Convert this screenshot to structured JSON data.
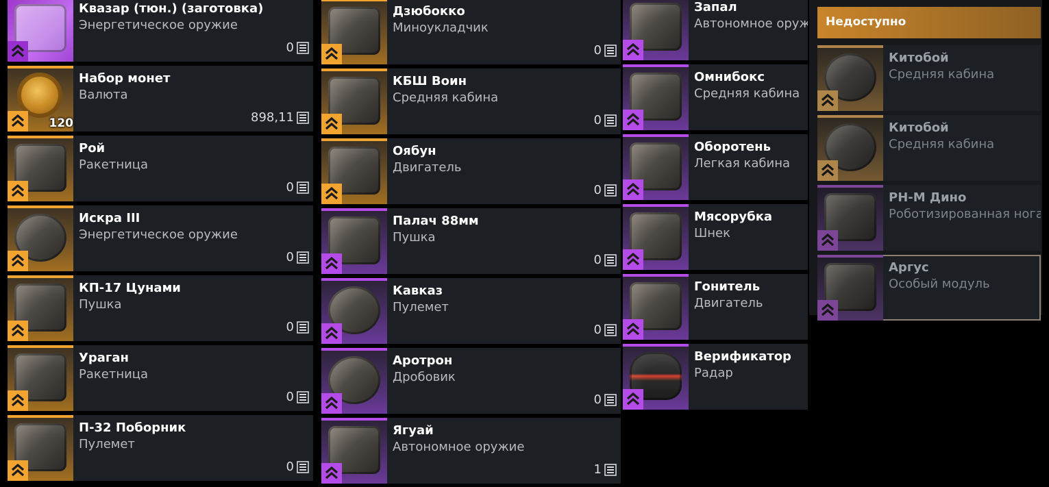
{
  "icons": {
    "count": "list-icon",
    "badge": "chevron-up-icon"
  },
  "colors": {
    "orange": "#f2a431",
    "purple": "#b54be8",
    "card": "#1c1f23",
    "header": "#c9852a"
  },
  "columns": [
    {
      "items": [
        {
          "name": "Квазар (тюн.) (заготовка)",
          "type": "Энергетическое оружие",
          "count": "0",
          "rarity": "magenta"
        },
        {
          "name": "Набор монет",
          "type": "Валюта",
          "count": "898,11",
          "rarity": "orange",
          "qty": "120",
          "kind": "coin"
        },
        {
          "name": "Рой",
          "type": "Ракетница",
          "count": "0",
          "rarity": "orange"
        },
        {
          "name": "Искра III",
          "type": "Энергетическое оружие",
          "count": "0",
          "rarity": "orange",
          "kind": "round"
        },
        {
          "name": "КП-17 Цунами",
          "type": "Пушка",
          "count": "0",
          "rarity": "orange"
        },
        {
          "name": "Ураган",
          "type": "Ракетница",
          "count": "0",
          "rarity": "orange"
        },
        {
          "name": "П-32 Поборник",
          "type": "Пулемет",
          "count": "0",
          "rarity": "orange"
        }
      ]
    },
    {
      "items": [
        {
          "name": "Дзюбокко",
          "type": "Миноукладчик",
          "count": "0",
          "rarity": "orange"
        },
        {
          "name": "КБШ Воин",
          "type": "Средняя кабина",
          "count": "0",
          "rarity": "orange"
        },
        {
          "name": "Оябун",
          "type": "Двигатель",
          "count": "0",
          "rarity": "orange"
        },
        {
          "name": "Палач 88мм",
          "type": "Пушка",
          "count": "0",
          "rarity": "purple"
        },
        {
          "name": "Кавказ",
          "type": "Пулемет",
          "count": "0",
          "rarity": "purple",
          "kind": "round"
        },
        {
          "name": "Аротрон",
          "type": "Дробовик",
          "count": "0",
          "rarity": "purple",
          "kind": "round"
        },
        {
          "name": "Ягуай",
          "type": "Автономное оружие",
          "count": "1",
          "rarity": "purple"
        }
      ]
    },
    {
      "items": [
        {
          "name": "Запал",
          "type": "Автономное оружие",
          "count": "",
          "rarity": "purple"
        },
        {
          "name": "Омнибокс",
          "type": "Средняя кабина",
          "count": "",
          "rarity": "purple"
        },
        {
          "name": "Оборотень",
          "type": "Легкая кабина",
          "count": "",
          "rarity": "purple"
        },
        {
          "name": "Мясорубка",
          "type": "Шнек",
          "count": "",
          "rarity": "purple"
        },
        {
          "name": "Гонитель",
          "type": "Двигатель",
          "count": "",
          "rarity": "purple"
        },
        {
          "name": "Верификатор",
          "type": "Радар",
          "count": "",
          "rarity": "purple",
          "kind": "red"
        }
      ]
    }
  ],
  "unavailable": {
    "title": "Недоступно",
    "items": [
      {
        "name": "Китобой",
        "type": "Средняя кабина",
        "rarity": "orange",
        "kind": "round"
      },
      {
        "name": "Китобой",
        "type": "Средняя кабина",
        "rarity": "orange",
        "kind": "round"
      },
      {
        "name": "РН-М Дино",
        "type": "Роботизированная нога",
        "rarity": "purple"
      },
      {
        "name": "Аргус",
        "type": "Особый модуль",
        "rarity": "purple",
        "selected": true
      }
    ]
  }
}
